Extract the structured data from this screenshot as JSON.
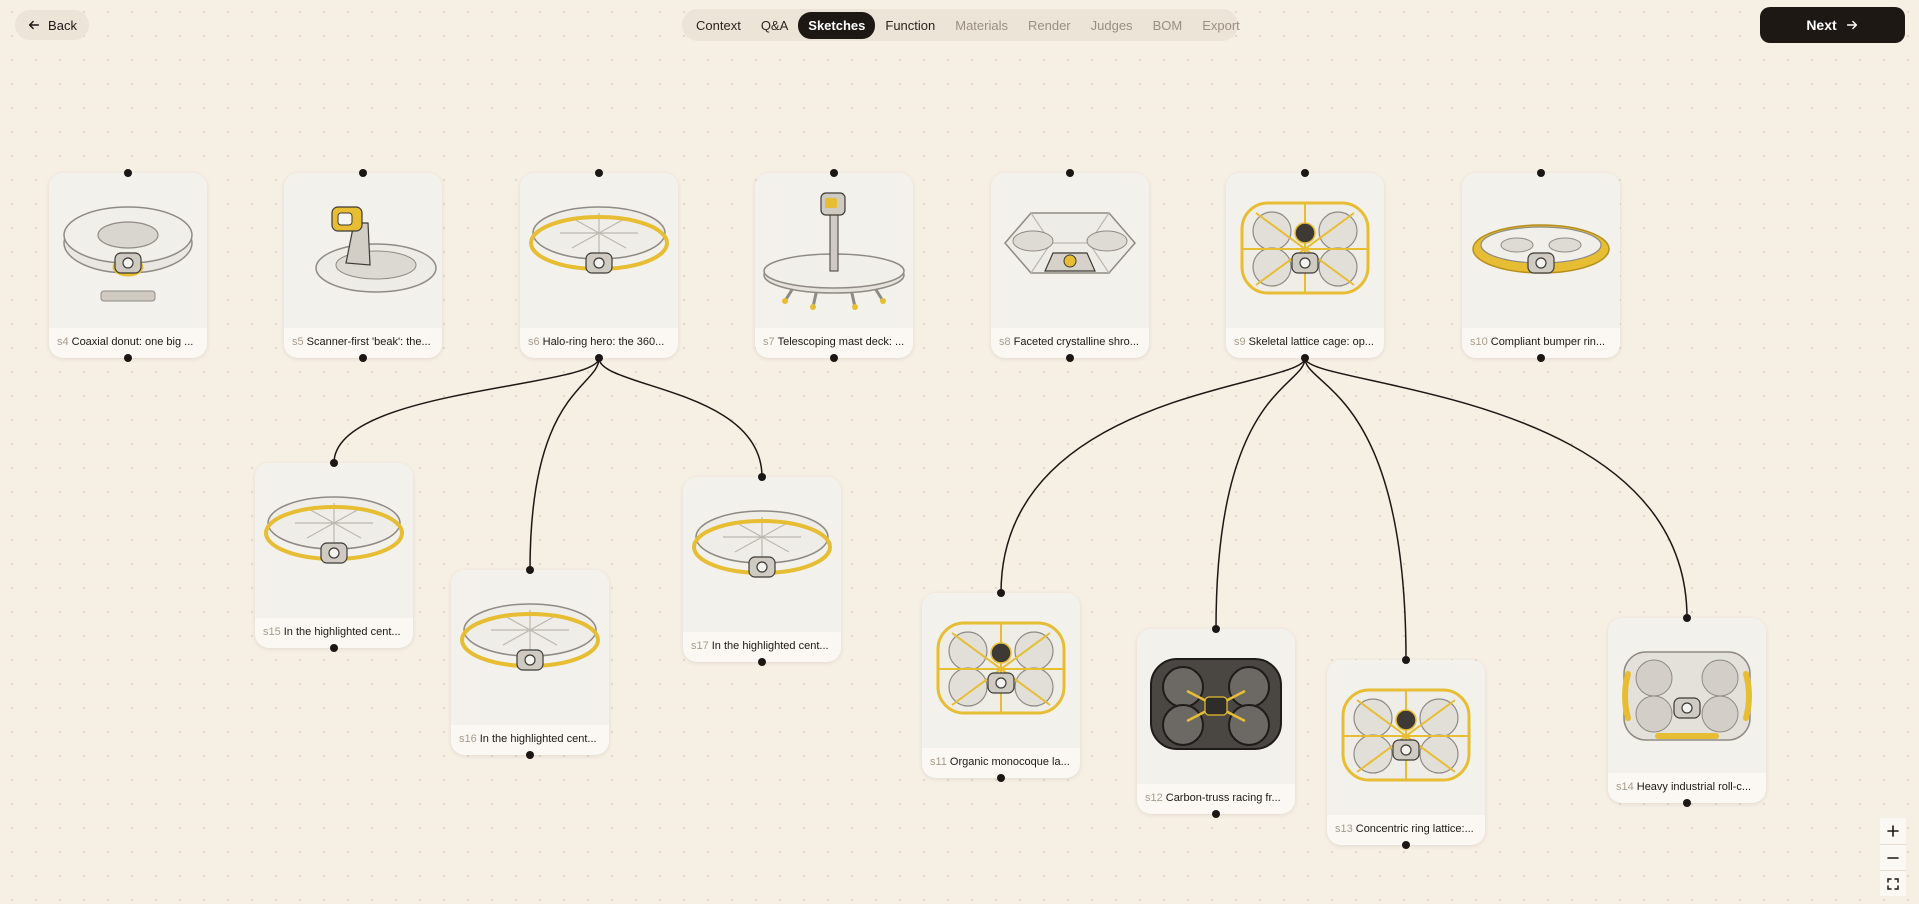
{
  "header": {
    "back_label": "Back",
    "next_label": "Next",
    "tabs": [
      {
        "label": "Context",
        "state": "done"
      },
      {
        "label": "Q&A",
        "state": "done"
      },
      {
        "label": "Sketches",
        "state": "active"
      },
      {
        "label": "Function",
        "state": "done"
      },
      {
        "label": "Materials",
        "state": "pending"
      },
      {
        "label": "Render",
        "state": "pending"
      },
      {
        "label": "Judges",
        "state": "pending"
      },
      {
        "label": "BOM",
        "state": "pending"
      },
      {
        "label": "Export",
        "state": "pending"
      }
    ]
  },
  "canvas": {
    "nodes": [
      {
        "id": "s4",
        "label": "Coaxial donut: one big ...",
        "variant": "donut"
      },
      {
        "id": "s5",
        "label": "Scanner-first 'beak': the...",
        "variant": "beak"
      },
      {
        "id": "s6",
        "label": "Halo-ring hero: the 360...",
        "variant": "halo"
      },
      {
        "id": "s7",
        "label": "Telescoping mast deck: ...",
        "variant": "mast"
      },
      {
        "id": "s8",
        "label": "Faceted crystalline shro...",
        "variant": "faceted"
      },
      {
        "id": "s9",
        "label": "Skeletal lattice cage: op...",
        "variant": "lattice"
      },
      {
        "id": "s10",
        "label": "Compliant bumper rin...",
        "variant": "bumper"
      },
      {
        "id": "s15",
        "label": "In the highlighted cent...",
        "variant": "halo"
      },
      {
        "id": "s16",
        "label": "In the highlighted cent...",
        "variant": "halo"
      },
      {
        "id": "s17",
        "label": "In the highlighted cent...",
        "variant": "halo"
      },
      {
        "id": "s11",
        "label": "Organic monocoque la...",
        "variant": "lattice"
      },
      {
        "id": "s12",
        "label": "Carbon-truss racing fr...",
        "variant": "carbon"
      },
      {
        "id": "s13",
        "label": "Concentric ring lattice:...",
        "variant": "lattice"
      },
      {
        "id": "s14",
        "label": "Heavy industrial roll-c...",
        "variant": "industrial"
      }
    ],
    "edges": [
      [
        "s6",
        "s15"
      ],
      [
        "s6",
        "s16"
      ],
      [
        "s6",
        "s17"
      ],
      [
        "s9",
        "s11"
      ],
      [
        "s9",
        "s12"
      ],
      [
        "s9",
        "s13"
      ],
      [
        "s9",
        "s14"
      ]
    ]
  },
  "colors": {
    "background": "#f6efe4",
    "ink": "#1c1714",
    "accent_yellow": "#e7bd33",
    "muted": "#a79b8b"
  },
  "icons": {
    "back": "arrow-left-icon",
    "next": "arrow-right-icon",
    "zoom_in": "plus-icon",
    "zoom_out": "minus-icon",
    "fit": "fullscreen-icon"
  }
}
